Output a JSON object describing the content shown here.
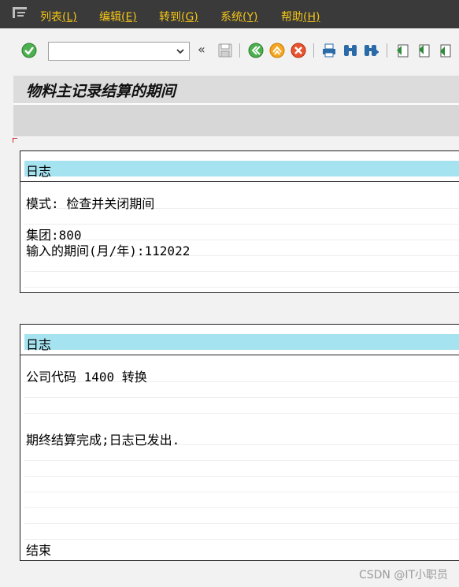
{
  "menu": {
    "items": [
      {
        "label": "列表",
        "key": "(L)"
      },
      {
        "label": "编辑",
        "key": "(E)"
      },
      {
        "label": "转到",
        "key": "(G)"
      },
      {
        "label": "系统",
        "key": "(Y)"
      },
      {
        "label": "帮助",
        "key": "(H)"
      }
    ]
  },
  "toolbar": {
    "command_value": "",
    "back_glyph": "«"
  },
  "title": "物料主记录结算的期间",
  "log1": {
    "header": "日志",
    "lines": [
      "模式: 检查并关闭期间",
      "",
      "集团:800",
      "输入的期间(月/年):112022",
      ""
    ]
  },
  "log2": {
    "header": "日志",
    "lines": [
      "公司代码 1400 转换",
      "",
      "",
      "期终结算完成;日志已发出.",
      "",
      "",
      "",
      "",
      "",
      "",
      "结束"
    ]
  },
  "watermark": "CSDN @IT小职员",
  "colors": {
    "menubar": "#3a3a3a",
    "menu_text": "#f5c518",
    "log_header": "#a6e3f1"
  }
}
